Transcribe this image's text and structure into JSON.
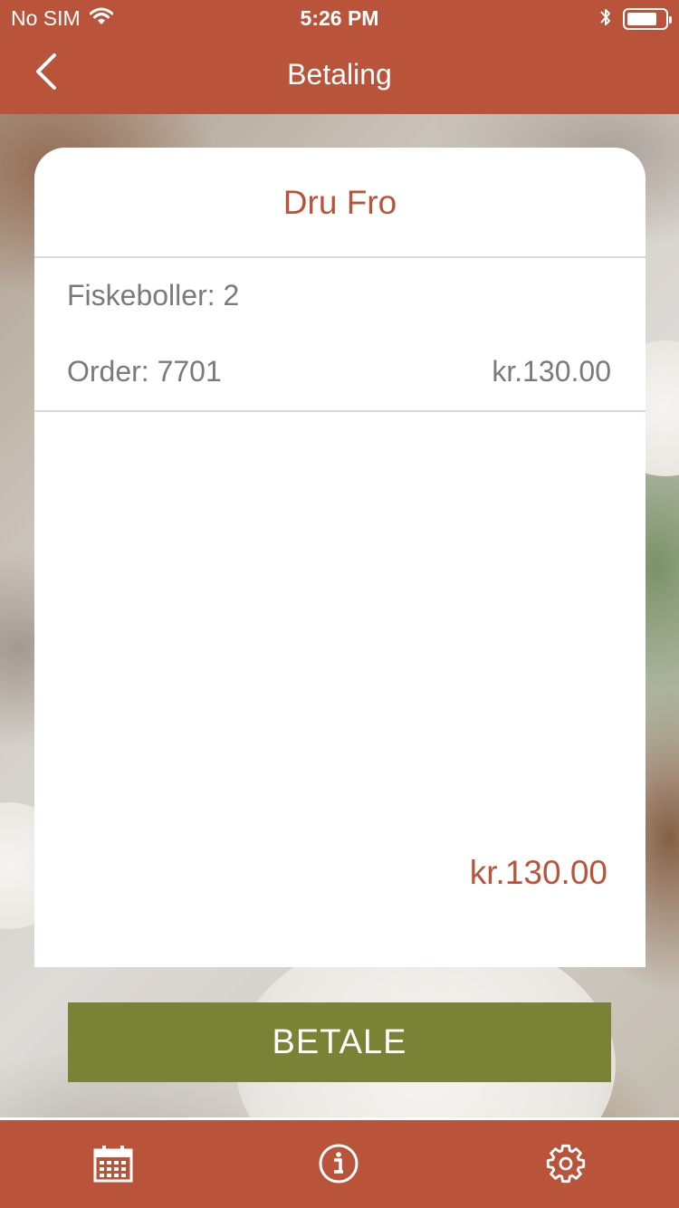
{
  "status_bar": {
    "carrier": "No SIM",
    "time": "5:26 PM",
    "icons": [
      "wifi-icon",
      "bluetooth-icon",
      "battery-icon"
    ],
    "battery_level_pct": 80
  },
  "nav": {
    "title": "Betaling",
    "back_icon": "chevron-left-icon"
  },
  "receipt": {
    "restaurant_name": "Dru Fro",
    "item": "Fiskeboller: 2",
    "order_label": "Order: 7701",
    "order_amount": "kr.130.00",
    "total": "kr.130.00"
  },
  "pay_button": {
    "label": "BETALE"
  },
  "tab_bar": {
    "tabs": [
      {
        "icon": "calendar-icon"
      },
      {
        "icon": "info-icon"
      },
      {
        "icon": "gear-icon"
      }
    ]
  },
  "colors": {
    "brand": "#b9543b",
    "pay_button": "#7a8235",
    "text_muted": "#7a7a7a",
    "divider": "#d9d9d9"
  }
}
